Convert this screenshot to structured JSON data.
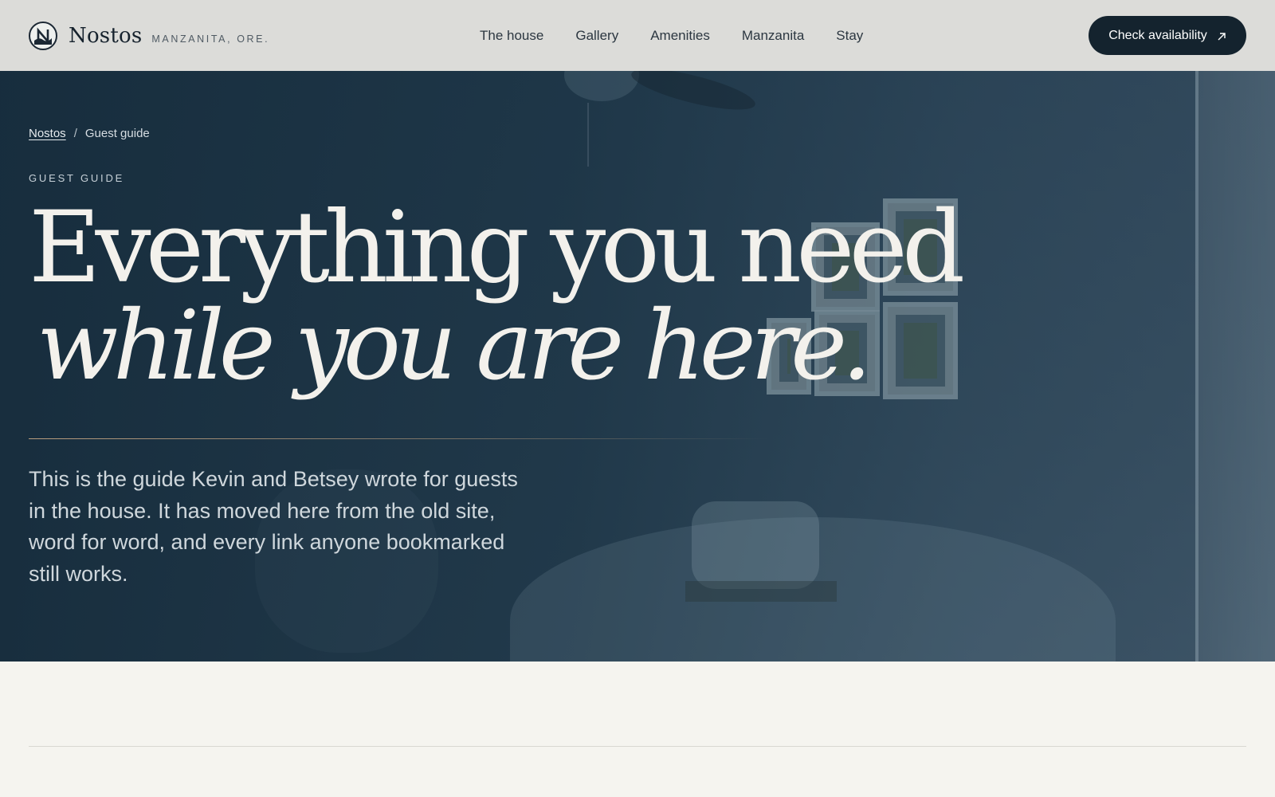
{
  "header": {
    "brand_name": "Nostos",
    "brand_place": "MANZANITA, ORE.",
    "logo_icon": "nostos-logo-icon",
    "nav": [
      {
        "label": "The house"
      },
      {
        "label": "Gallery"
      },
      {
        "label": "Amenities"
      },
      {
        "label": "Manzanita"
      },
      {
        "label": "Stay"
      }
    ],
    "cta_label": "Check availability",
    "cta_icon": "arrow-up-right-icon"
  },
  "hero": {
    "breadcrumb": {
      "home": "Nostos",
      "separator": "/",
      "current": "Guest guide"
    },
    "eyebrow": "GUEST GUIDE",
    "headline_line1": "Everything you need",
    "headline_line2": "while you are here.",
    "intro": "This is the guide Kevin and Betsey wrote for guests in the house. It has moved here from the old site, word for word, and every link anyone bookmarked still works."
  },
  "colors": {
    "page_background": "#f5f4ef",
    "header_background": "#dcdcd9",
    "cta_background": "#14232e",
    "hero_overlay": "#1a3243",
    "accent_rule": "#b99d7e"
  }
}
